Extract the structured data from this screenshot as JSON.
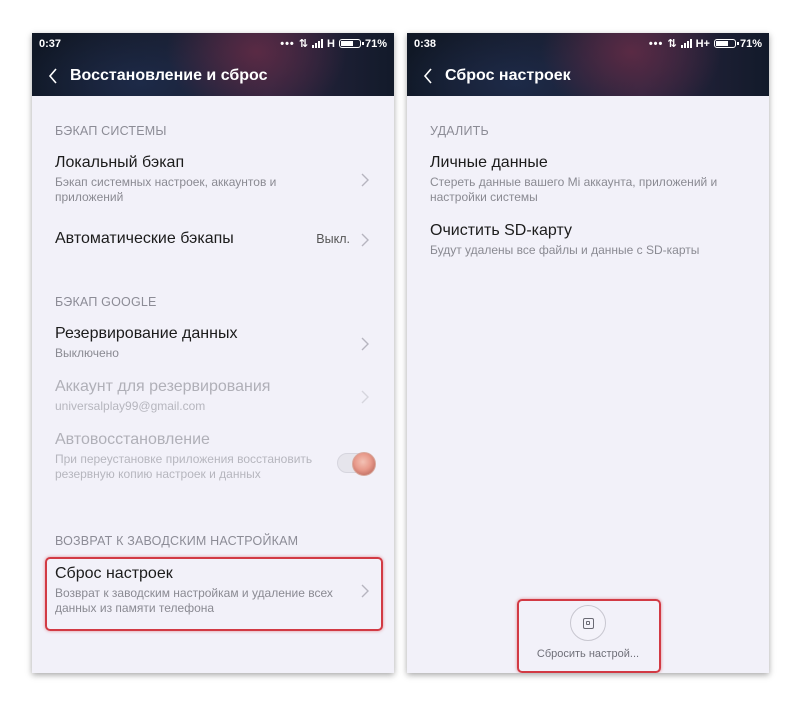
{
  "left": {
    "status": {
      "time": "0:37",
      "network": "H",
      "battery": "71%"
    },
    "title": "Восстановление и сброс",
    "sections": {
      "backup_system": {
        "header": "БЭКАП СИСТЕМЫ",
        "local_backup": {
          "title": "Локальный бэкап",
          "subtitle": "Бэкап системных настроек, аккаунтов и приложений"
        },
        "auto_backups": {
          "title": "Автоматические бэкапы",
          "value": "Выкл."
        }
      },
      "backup_google": {
        "header": "БЭКАП GOOGLE",
        "data_backup": {
          "title": "Резервирование данных",
          "subtitle": "Выключено"
        },
        "backup_account": {
          "title": "Аккаунт для резервирования",
          "subtitle": "universalplay99@gmail.com"
        },
        "auto_restore": {
          "title": "Автовосстановление",
          "subtitle": "При переустановке приложения восстановить резервную копию настроек и данных",
          "toggle_on": true
        }
      },
      "factory": {
        "header": "ВОЗВРАТ К ЗАВОДСКИМ НАСТРОЙКАМ",
        "reset": {
          "title": "Сброс настроек",
          "subtitle": "Возврат к заводским настройкам и удаление всех данных из памяти телефона"
        }
      }
    }
  },
  "right": {
    "status": {
      "time": "0:38",
      "network": "H+",
      "battery": "71%"
    },
    "title": "Сброс настроек",
    "section_header": "УДАЛИТЬ",
    "personal_data": {
      "title": "Личные данные",
      "subtitle": "Стереть данные вашего Mi аккаунта, приложений и настройки системы"
    },
    "clear_sd": {
      "title": "Очистить SD-карту",
      "subtitle": "Будут удалены все файлы и данные с SD-карты"
    },
    "reset_button_label": "Сбросить настрой..."
  },
  "colors": {
    "highlight": "#d23a44",
    "background": "#f2f1f9",
    "toggle_knob": "#e89a8b"
  },
  "icons": [
    "back-icon",
    "chevron-right-icon",
    "signal-icon",
    "battery-icon",
    "reset-icon"
  ]
}
